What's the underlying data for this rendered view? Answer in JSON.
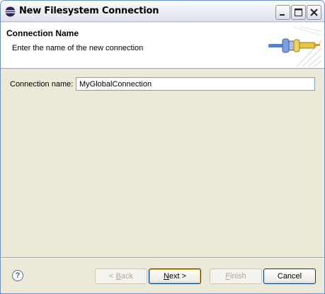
{
  "window": {
    "title": "New Filesystem Connection",
    "icon": "eclipse-icon"
  },
  "titlebar_buttons": {
    "minimize_icon": "minimize-icon",
    "maximize_icon": "maximize-icon",
    "close_icon": "close-icon"
  },
  "header": {
    "title": "Connection Name",
    "description": "Enter the name of the new connection",
    "graphic": "connection-plug-graphic"
  },
  "form": {
    "connection_name_label": "Connection name:",
    "connection_name_value": "MyGlobalConnection"
  },
  "buttons": {
    "help_icon": "help-icon",
    "back": {
      "label_prefix": "< ",
      "mnemonic": "B",
      "label_suffix": "ack",
      "enabled": false
    },
    "next": {
      "mnemonic": "N",
      "label_suffix": "ext >",
      "enabled": true
    },
    "finish": {
      "mnemonic": "F",
      "label_suffix": "inish",
      "enabled": false
    },
    "cancel": {
      "label": "Cancel",
      "enabled": true
    }
  },
  "colors": {
    "dialog_bg": "#ece9d8",
    "header_bg": "#ffffff",
    "button_border": "#003c74",
    "input_border": "#7f9db9",
    "graphic_blue": "#5b7fc7",
    "graphic_yellow": "#e8c34a"
  }
}
